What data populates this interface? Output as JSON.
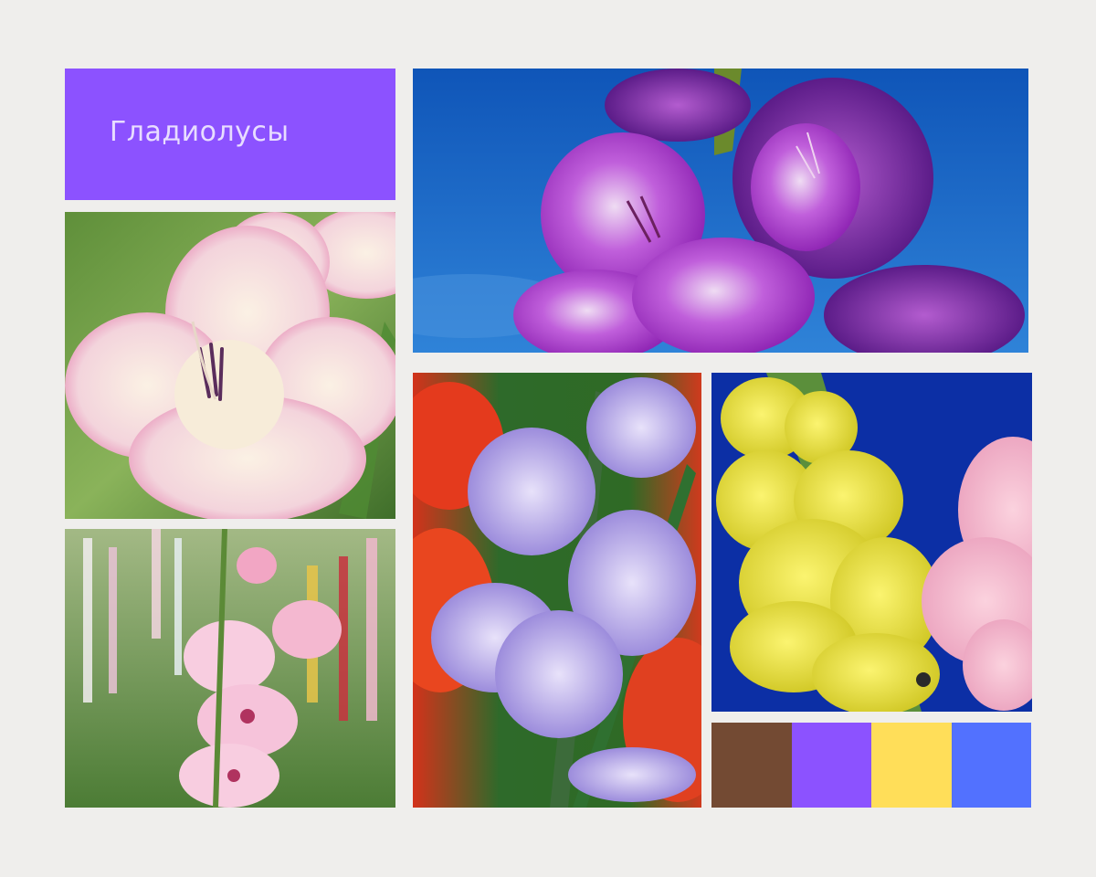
{
  "title": "Гладиолусы",
  "colors": {
    "background": "#efeeec",
    "title_card": "#8c52ff",
    "title_text": "#e8ddff"
  },
  "palette": [
    {
      "name": "brown",
      "hex": "#734a33"
    },
    {
      "name": "violet",
      "hex": "#8c52ff"
    },
    {
      "name": "yellow",
      "hex": "#ffde59"
    },
    {
      "name": "blue",
      "hex": "#5271ff"
    }
  ]
}
